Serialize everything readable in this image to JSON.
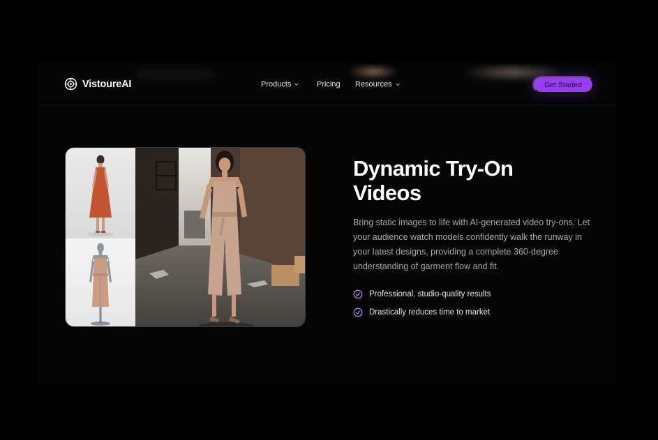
{
  "brand": {
    "name": "VistoureAI"
  },
  "nav": {
    "products": "Products",
    "pricing": "Pricing",
    "resources": "Resources"
  },
  "cta": {
    "label": "Get Started"
  },
  "hero": {
    "title_line1": "Dynamic Try-On",
    "title_line2": "Videos",
    "description": "Bring static images to life with AI-generated video try-ons. Let your audience watch models confidently walk the runway in your latest designs, providing a complete 360-degree understanding of garment flow and fit.",
    "features": [
      "Professional, studio-quality results",
      "Drastically reduces time to market"
    ]
  },
  "colors": {
    "background": "#000000",
    "accent": "#9a3cf5",
    "check": "#b18af0",
    "body_text": "#a9a9ae"
  }
}
